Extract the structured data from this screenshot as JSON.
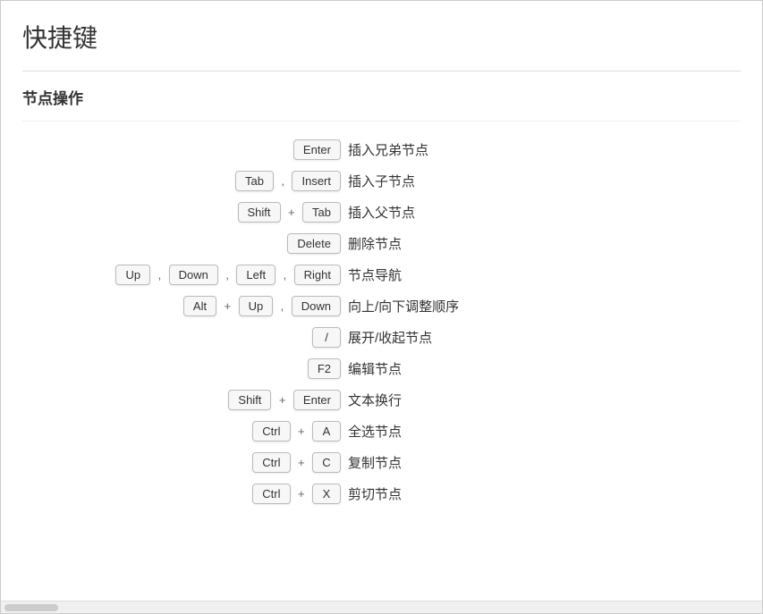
{
  "page": {
    "title": "快捷键"
  },
  "sections": [
    {
      "id": "node-ops",
      "title": "节点操作",
      "shortcuts": [
        {
          "keys": [
            [
              "Enter"
            ]
          ],
          "description": "插入兄弟节点"
        },
        {
          "keys": [
            [
              "Tab"
            ],
            ",",
            [
              "Insert"
            ]
          ],
          "description": "插入子节点"
        },
        {
          "keys": [
            [
              "Shift"
            ],
            "+",
            [
              "Tab"
            ]
          ],
          "description": "插入父节点"
        },
        {
          "keys": [
            [
              "Delete"
            ]
          ],
          "description": "删除节点"
        },
        {
          "keys": [
            [
              "Up"
            ],
            ",",
            [
              "Down"
            ],
            ",",
            [
              "Left"
            ],
            ",",
            [
              "Right"
            ]
          ],
          "description": "节点导航"
        },
        {
          "keys": [
            [
              "Alt"
            ],
            "+",
            [
              "Up"
            ],
            ",",
            [
              "Down"
            ]
          ],
          "description": "向上/向下调整顺序"
        },
        {
          "keys": [
            [
              "/"
            ]
          ],
          "description": "展开/收起节点"
        },
        {
          "keys": [
            [
              "F2"
            ]
          ],
          "description": "编辑节点"
        },
        {
          "keys": [
            [
              "Shift"
            ],
            "+",
            [
              "Enter"
            ]
          ],
          "description": "文本换行"
        },
        {
          "keys": [
            [
              "Ctrl"
            ],
            "+",
            [
              "A"
            ]
          ],
          "description": "全选节点"
        },
        {
          "keys": [
            [
              "Ctrl"
            ],
            "+",
            [
              "C"
            ]
          ],
          "description": "复制节点"
        },
        {
          "keys": [
            [
              "Ctrl"
            ],
            "+",
            [
              "X"
            ]
          ],
          "description": "剪切节点"
        }
      ]
    }
  ]
}
